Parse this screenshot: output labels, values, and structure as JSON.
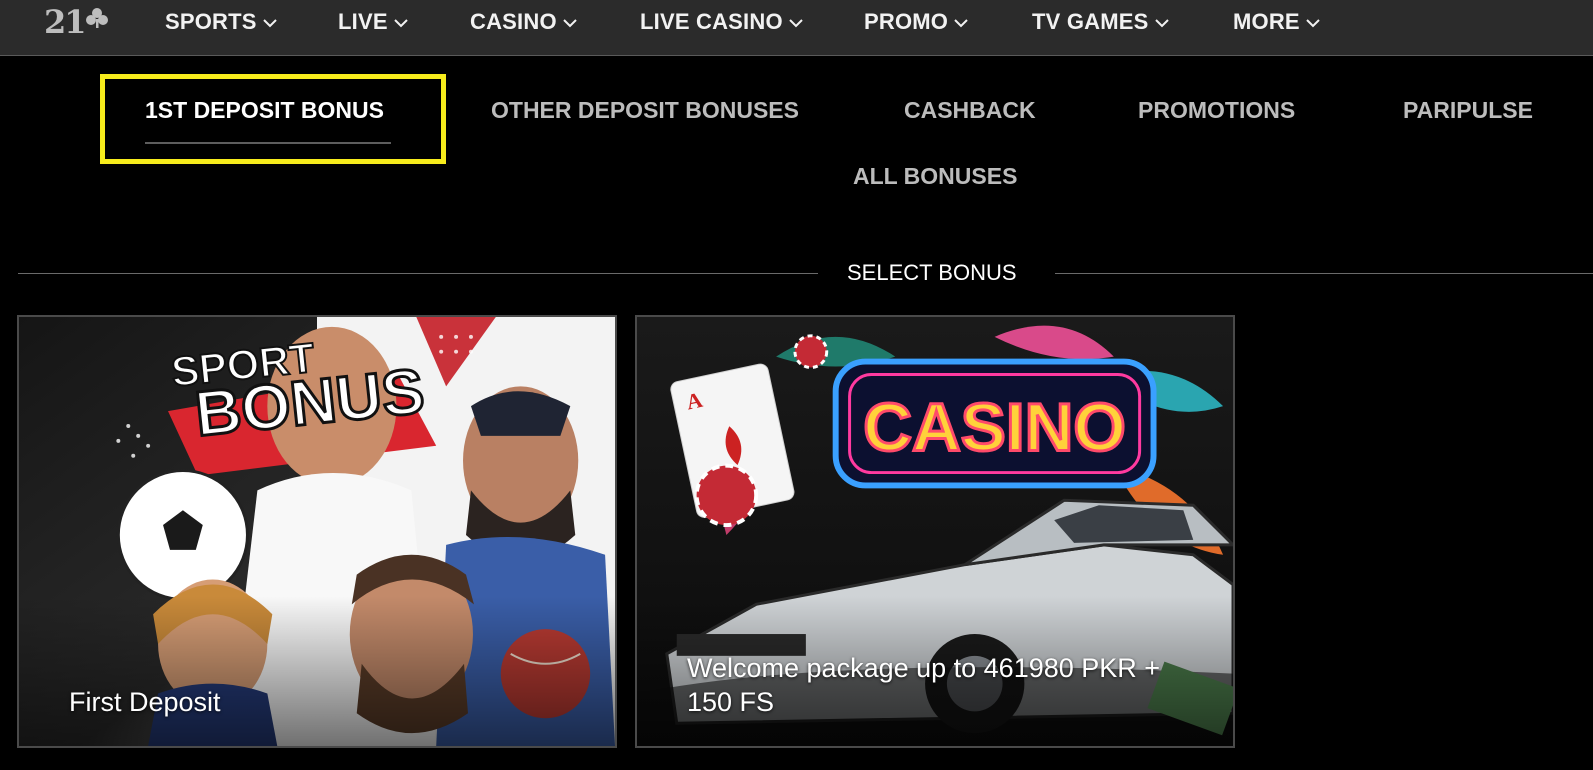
{
  "header": {
    "logo_text": "21",
    "nav": [
      {
        "label": "SPORTS"
      },
      {
        "label": "LIVE"
      },
      {
        "label": "CASINO"
      },
      {
        "label": "LIVE CASINO"
      },
      {
        "label": "PROMO"
      },
      {
        "label": "TV GAMES"
      },
      {
        "label": "MORE"
      }
    ]
  },
  "tabs": [
    {
      "label": "1ST DEPOSIT BONUS",
      "active": true
    },
    {
      "label": "OTHER DEPOSIT BONUSES",
      "active": false
    },
    {
      "label": "CASHBACK",
      "active": false
    },
    {
      "label": "PROMOTIONS",
      "active": false
    },
    {
      "label": "PARIPULSE",
      "active": false
    },
    {
      "label": "ALL BONUSES",
      "active": false
    }
  ],
  "section": {
    "title": "SELECT BONUS"
  },
  "cards": [
    {
      "title": "First Deposit",
      "image_text_line1": "SPORT",
      "image_text_line2": "BONUS"
    },
    {
      "title": "Welcome package up to 461980 PKR + 150 FS",
      "image_text": "CASINO"
    }
  ],
  "colors": {
    "topbar": "#2b2b2b",
    "background": "#000000",
    "highlight": "#f7ec1c",
    "inactive_tab": "#bcbcbc"
  }
}
